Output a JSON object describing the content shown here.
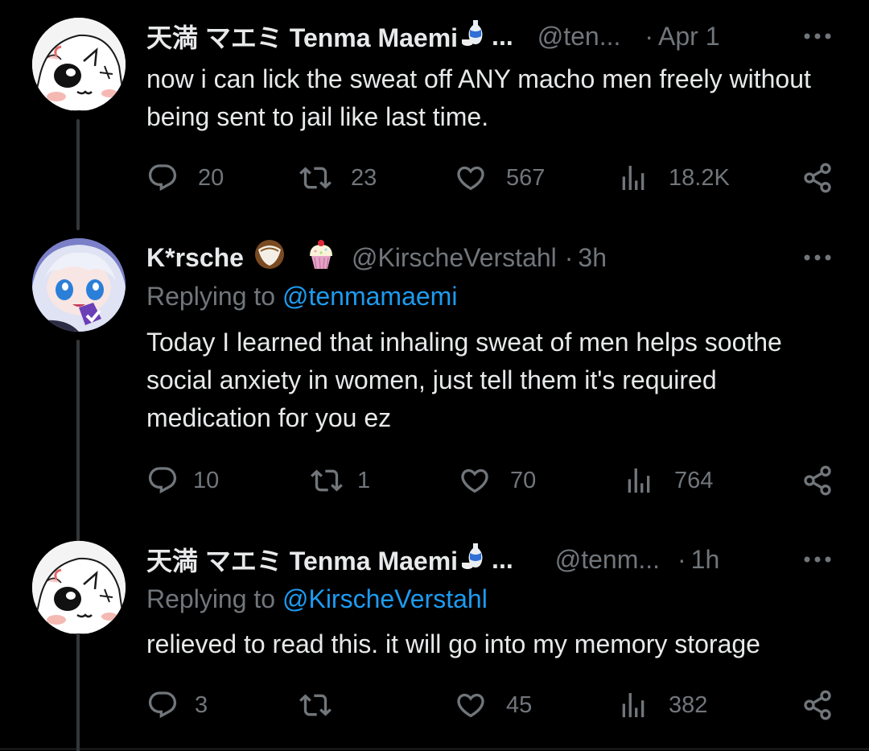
{
  "tweets": [
    {
      "display_name": "天満 マエミ Tenma Maemi",
      "name_ellipsis": "...",
      "handle": "@ten...",
      "dot": "·",
      "time": "Apr 1",
      "text": "now i can lick the sweat off ANY macho men freely without being sent to jail like last time.",
      "replies": "20",
      "retweets": "23",
      "likes": "567",
      "views": "18.2K"
    },
    {
      "display_name": "K*rsche",
      "handle": "@KirscheVerstahl",
      "dot": "·",
      "time": "3h",
      "replying_label": "Replying to",
      "replying_to": "@tenmamaemi",
      "text": "Today I learned that inhaling sweat of men helps soothe social anxiety in women, just tell them it's required medication for you ez",
      "replies": "10",
      "retweets": "1",
      "likes": "70",
      "views": "764"
    },
    {
      "display_name": "天満 マエミ Tenma Maemi",
      "name_ellipsis": "...",
      "handle": "@tenm...",
      "dot": "·",
      "time": "1h",
      "replying_label": "Replying to",
      "replying_to": "@KirscheVerstahl",
      "text": "relieved to read this. it will go into my memory storage",
      "replies": "3",
      "retweets": "",
      "likes": "45",
      "views": "382"
    }
  ],
  "icons": {
    "reply": "reply-icon",
    "retweet": "retweet-icon",
    "like": "heart-icon",
    "views": "views-icon",
    "share": "share-icon",
    "more": "more-icon",
    "sake": "sake-emoji-icon",
    "coconut": "coconut-emoji-icon",
    "cupcake": "cupcake-emoji-icon"
  },
  "colors": {
    "background": "#000000",
    "text_primary": "#e7e9ea",
    "text_secondary": "#71767b",
    "link": "#1d9bf0",
    "connector": "#333639"
  }
}
